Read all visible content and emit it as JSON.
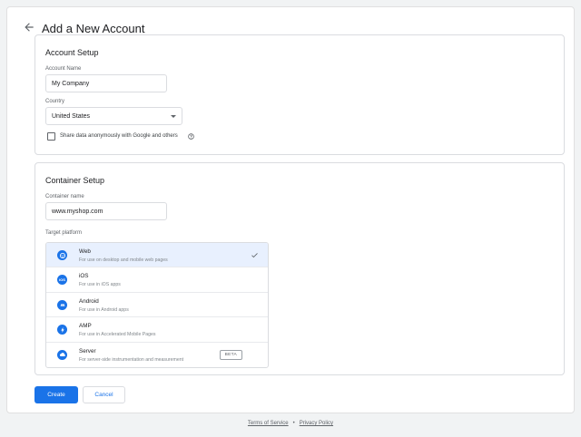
{
  "page": {
    "title": "Add a New Account"
  },
  "account_setup": {
    "title": "Account Setup",
    "account_name_label": "Account Name",
    "account_name_value": "My Company",
    "country_label": "Country",
    "country_value": "United States",
    "share_label": "Share data anonymously with Google and others"
  },
  "container_setup": {
    "title": "Container Setup",
    "container_name_label": "Container name",
    "container_name_value": "www.myshop.com",
    "target_platform_label": "Target platform",
    "platforms": [
      {
        "name": "Web",
        "desc": "For use on desktop and mobile web pages",
        "icon": "web-icon",
        "selected": true
      },
      {
        "name": "iOS",
        "desc": "For use in iOS apps",
        "icon": "ios-icon",
        "selected": false
      },
      {
        "name": "Android",
        "desc": "For use in Android apps",
        "icon": "android-icon",
        "selected": false
      },
      {
        "name": "AMP",
        "desc": "For use in Accelerated Mobile Pages",
        "icon": "amp-icon",
        "selected": false
      },
      {
        "name": "Server",
        "desc": "For server-side instrumentation and measurement",
        "icon": "server-icon",
        "selected": false,
        "badge": "BETA"
      }
    ]
  },
  "actions": {
    "create_label": "Create",
    "cancel_label": "Cancel"
  },
  "footer": {
    "terms": "Terms of Service",
    "separator": "•",
    "privacy": "Privacy Policy"
  },
  "colors": {
    "primary": "#1a73e8",
    "selected_bg": "#e8f0fe",
    "border": "#dadce0"
  }
}
